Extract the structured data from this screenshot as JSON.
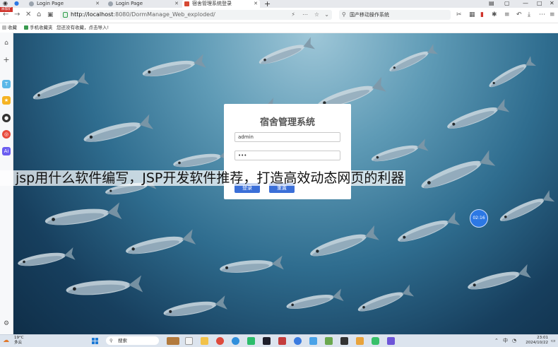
{
  "browser": {
    "tabs": [
      {
        "title": "Login Page"
      },
      {
        "title": "Login Page"
      },
      {
        "title": "宿舍管理系统登录"
      }
    ],
    "new_tab_glyph": "+",
    "window_controls": [
      "minimize",
      "maximize",
      "close"
    ],
    "address": {
      "host": "http://localhost",
      "path": ":8080/DormManage_Web_exploded/"
    },
    "search_text": "国产移动操作系统",
    "search_icon": "search-icon"
  },
  "bookmarks": {
    "badge": "添加扩",
    "items": [
      {
        "label": "收藏"
      },
      {
        "label": "手机收藏夹"
      },
      {
        "label": "您还没有收藏，点击导入!"
      }
    ]
  },
  "sidebar": {
    "icons": [
      "home-icon",
      "plus-icon",
      "translate-icon",
      "star-icon",
      "game-icon",
      "chrome-icon",
      "ai-icon",
      "settings-icon"
    ]
  },
  "login": {
    "title": "宿舍管理系统",
    "username": "admin",
    "password": "•••",
    "login_button": "登录",
    "reset_button": "重置"
  },
  "clock_widget": "02:16",
  "overlay_caption": "jsp用什么软件编写，JSP开发软件推荐，打造高效动态网页的利器",
  "taskbar": {
    "weather_temp": "19°C",
    "weather_desc": "多云",
    "search_placeholder": "搜索",
    "time": "23:01",
    "date": "2024/10/22",
    "ime": "中"
  },
  "colors": {
    "login_button": "#3b6fd8",
    "clock_widget": "#2c78e4",
    "tab_active": "#ffffff",
    "taskbar": "#dce4ee"
  }
}
